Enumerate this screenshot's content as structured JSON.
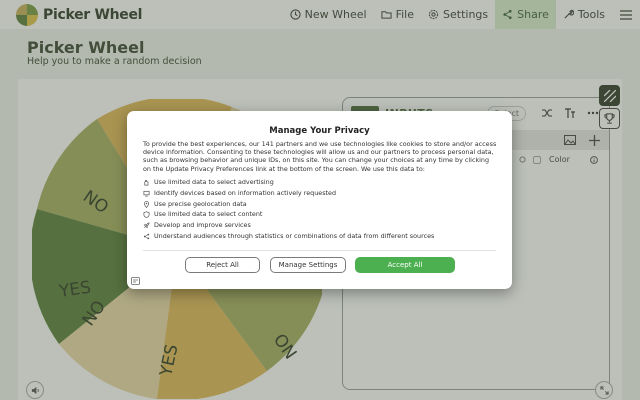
{
  "app": {
    "name": "Picker Wheel"
  },
  "nav": {
    "new_wheel": "New Wheel",
    "file": "File",
    "settings": "Settings",
    "share": "Share",
    "tools": "Tools"
  },
  "header": {
    "title": "Picker Wheel",
    "subtitle": "Help you to make a random decision"
  },
  "wheel": {
    "labels": [
      "YES",
      "NO",
      "YES",
      "NO"
    ]
  },
  "panel": {
    "title": "INPUTS",
    "select_placeholder": "Select",
    "color_label": "Color"
  },
  "consent": {
    "title": "Manage Your Privacy",
    "body": "To provide the best experiences, our 141 partners and we use technologies like cookies to store and/or access device information. Consenting to these technologies will allow us and our partners to process personal data, such as browsing behavior and unique IDs, on this site. You can change your choices at any time by clicking on the Update Privacy Preferences link at the bottom of the screen. We use this data to:",
    "purposes": [
      "Use limited data to select advertising",
      "Identify devices based on information actively requested",
      "Use precise geolocation data",
      "Use limited data to select content",
      "Develop and improve services",
      "Understand audiences through statistics or combinations of data from different sources"
    ],
    "reject_label": "Reject All",
    "manage_label": "Manage Settings",
    "accept_label": "Accept All"
  },
  "colors": {
    "accent_green": "#4caf50",
    "share_bg": "#d9edcf",
    "wheel_dark": "#5c7f3a",
    "wheel_olive": "#a8ae62",
    "wheel_gold": "#e0b857",
    "wheel_cream": "#ead8a8"
  }
}
